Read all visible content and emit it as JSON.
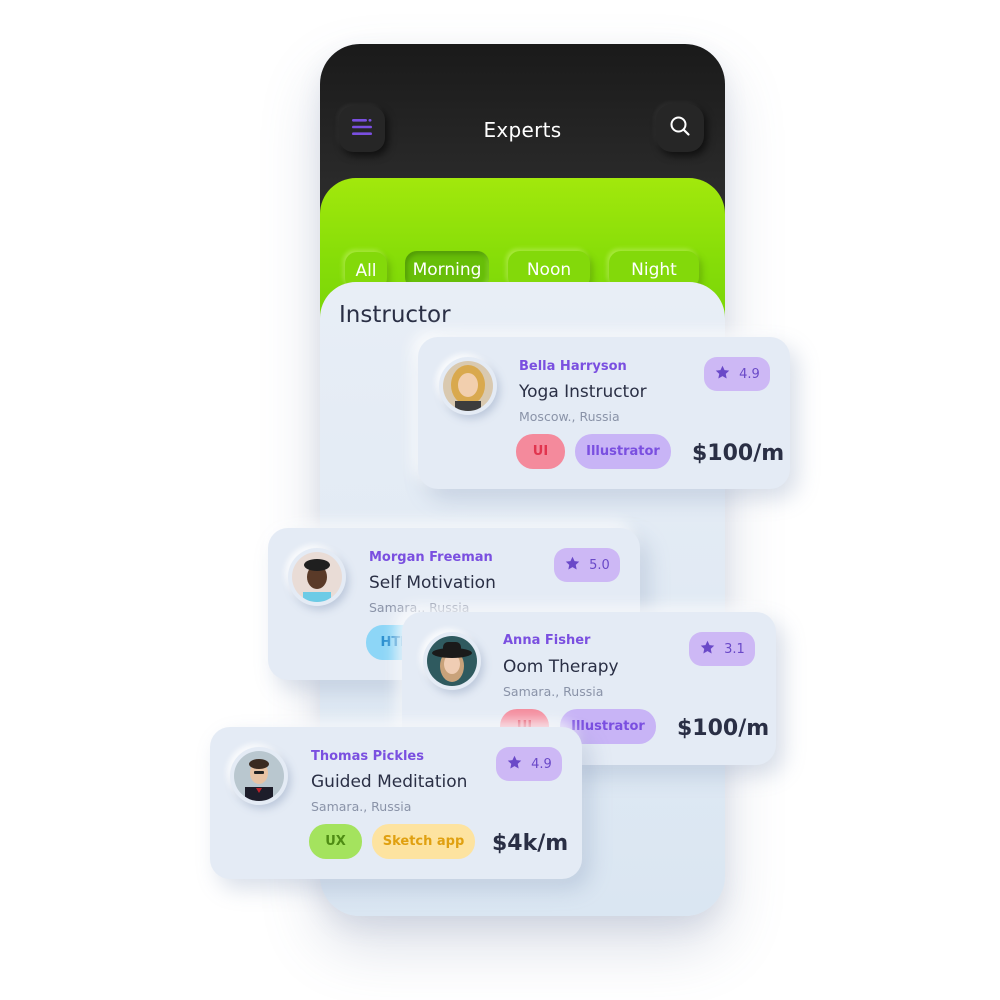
{
  "header": {
    "title": "Experts",
    "menu_icon": "menu-icon",
    "search_icon": "search-icon"
  },
  "filters": [
    {
      "label": "All",
      "active": false
    },
    {
      "label": "Morning",
      "active": true
    },
    {
      "label": "Noon",
      "active": false
    },
    {
      "label": "Night",
      "active": false
    }
  ],
  "section_title": "Instructor",
  "cards": [
    {
      "name": "Bella Harryson",
      "role": "Yoga Instructor",
      "location": "Moscow., Russia",
      "rating": "4.9",
      "tags": [
        {
          "label": "UI",
          "color": "#f48a9c",
          "text_color": "#e1344e"
        },
        {
          "label": "Illustrator",
          "color": "#c8b4f6",
          "text_color": "#7a4fe0"
        }
      ],
      "price": "$100/m"
    },
    {
      "name": "Morgan Freeman",
      "role": "Self Motivation",
      "location": "Samara., Russia",
      "rating": "5.0",
      "tags": [
        {
          "label": "HTML",
          "color": "#8dd6f7",
          "text_color": "#2a8fd0"
        }
      ]
    },
    {
      "name": "Anna Fisher",
      "role": "Oom Therapy",
      "location": "Samara., Russia",
      "rating": "3.1",
      "tags": [
        {
          "label": "UI",
          "color": "#f48a9c",
          "text_color": "#e1344e"
        },
        {
          "label": "Illustrator",
          "color": "#c8b4f6",
          "text_color": "#7a4fe0"
        }
      ],
      "price": "$100/m"
    },
    {
      "name": "Thomas Pickles",
      "role": "Guided Meditation",
      "location": "Samara., Russia",
      "rating": "4.9",
      "tags": [
        {
          "label": "UX",
          "color": "#a4e35e",
          "text_color": "#4e8c14"
        },
        {
          "label": "Sketch app",
          "color": "#fde3a0",
          "text_color": "#e0a010"
        }
      ],
      "price": "$4k/m"
    }
  ],
  "colors": {
    "accent_purple": "#7a4fe0",
    "lime": "#86dd08",
    "dark": "#1a1a1a",
    "card_bg": "#e4ebf5"
  }
}
